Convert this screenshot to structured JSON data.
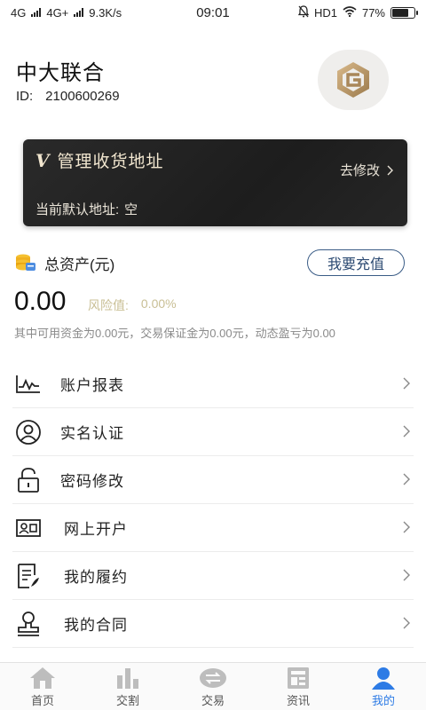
{
  "status_bar": {
    "network_1": "4G",
    "network_2": "4G+",
    "speed": "9.3K/s",
    "time": "09:01",
    "hd": "HD1",
    "battery": "77%",
    "battery_level": 0.77
  },
  "profile": {
    "name": "中大联合",
    "id_label": "ID:",
    "id_value": "2100600269"
  },
  "address_card": {
    "title": "管理收货地址",
    "edit_label": "去修改",
    "default_label": "当前默认地址:",
    "default_value": "空"
  },
  "assets": {
    "title": "总资产(元)",
    "recharge_label": "我要充值",
    "total": "0.00",
    "risk_label": "风险值:",
    "risk_value": "0.00%",
    "detail": "其中可用资金为0.00元，交易保证金为0.00元，动态盈亏为0.00"
  },
  "menu": [
    {
      "label": "账户报表",
      "icon": "chart-line-icon"
    },
    {
      "label": "实名认证",
      "icon": "user-circle-icon"
    },
    {
      "label": "密码修改",
      "icon": "lock-icon"
    },
    {
      "label": "网上开户",
      "icon": "id-card-icon"
    },
    {
      "label": "我的履约",
      "icon": "document-sign-icon"
    },
    {
      "label": "我的合同",
      "icon": "stamp-icon"
    }
  ],
  "tabs": [
    {
      "label": "首页",
      "icon": "home-icon"
    },
    {
      "label": "交割",
      "icon": "bar-chart-icon"
    },
    {
      "label": "交易",
      "icon": "exchange-icon"
    },
    {
      "label": "资讯",
      "icon": "news-icon"
    },
    {
      "label": "我的",
      "icon": "person-icon"
    }
  ],
  "colors": {
    "accent": "#2d7be5",
    "card_bg": "#1f1f1f",
    "card_text": "#f1e6cf",
    "recharge_border": "#3a5c86",
    "risk_text": "#c9bf95"
  }
}
